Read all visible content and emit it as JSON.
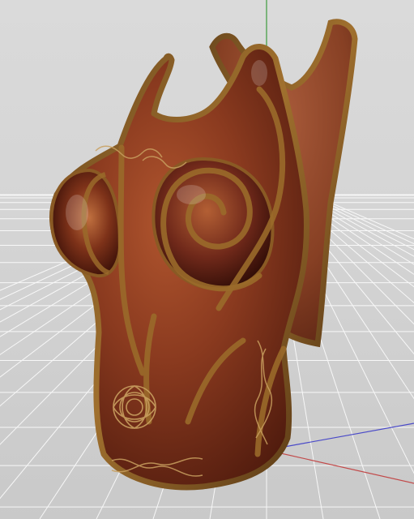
{
  "viewport": {
    "render_mode": "3d-preview",
    "subject": "leather-corset-model",
    "background_color": "#d7d7d7",
    "floor_grid": true,
    "grid_line_color": "#ffffff",
    "axis_colors": {
      "x": "#c24a4a",
      "y": "#3c9c3c",
      "z": "#4a4ac8"
    }
  },
  "model": {
    "leather_color": "#8a3d22",
    "leather_dark": "#4a1a0e",
    "trim_color": "#8a5a24",
    "knotwork_motif": "celtic-knot"
  }
}
